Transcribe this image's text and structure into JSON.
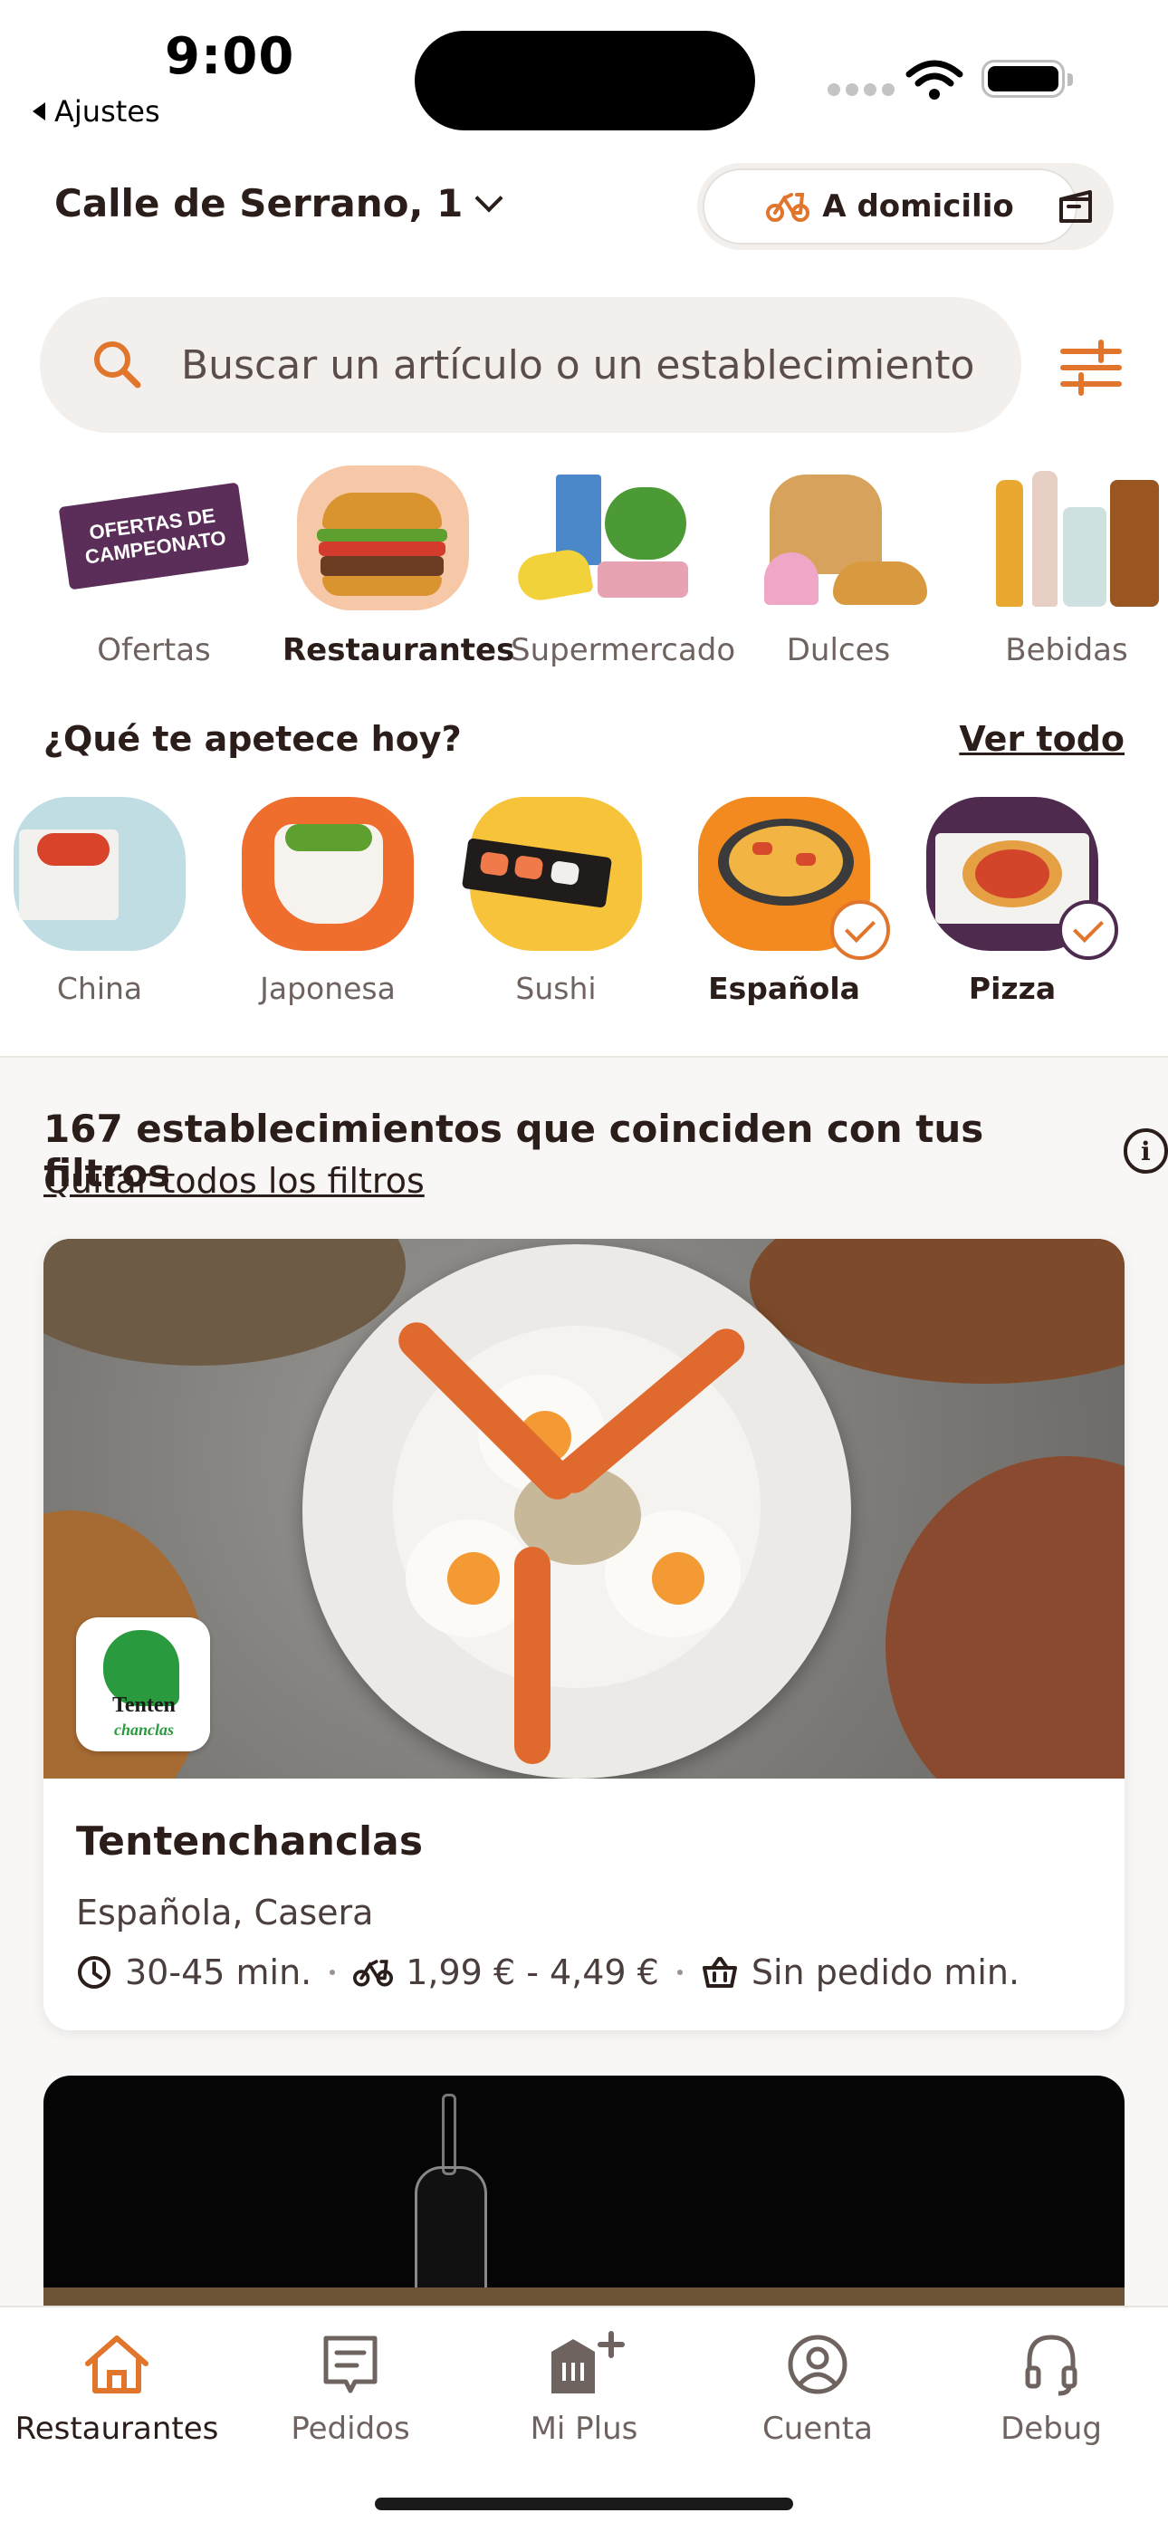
{
  "status_bar": {
    "time": "9:00",
    "back_app": "Ajustes"
  },
  "header": {
    "address": "Calle de Serrano, 1",
    "delivery_mode": "A domicilio"
  },
  "search": {
    "placeholder": "Buscar un artículo o un establecimiento"
  },
  "categories": [
    {
      "label": "Ofertas",
      "badge_line1": "OFERTAS DE",
      "badge_line2": "CAMPEONATO"
    },
    {
      "label": "Restaurantes"
    },
    {
      "label": "Supermercado"
    },
    {
      "label": "Dulces"
    },
    {
      "label": "Bebidas"
    }
  ],
  "cuisine_section": {
    "title": "¿Qué te apetece hoy?",
    "see_all": "Ver todo",
    "items": [
      {
        "label": "China",
        "selected": false,
        "bg": "#bfdde3"
      },
      {
        "label": "Japonesa",
        "selected": false,
        "bg": "#ef6d2d"
      },
      {
        "label": "Sushi",
        "selected": false,
        "bg": "#f6c33b"
      },
      {
        "label": "Española",
        "selected": true,
        "bg": "#f28a1f"
      },
      {
        "label": "Pizza",
        "selected": true,
        "bg": "#4e2a4f"
      }
    ]
  },
  "results": {
    "title": "167 establecimientos que coinciden con tus filtros",
    "clear_filters": "Quitar todos los filtros"
  },
  "restaurants": [
    {
      "name": "Tentenchanclas",
      "logo_line1": "Tenten",
      "logo_line2": "chanclas",
      "tags": "Española, Casera",
      "time": "30-45 min.",
      "delivery_fee": "1,99 € - 4,49 €",
      "min_order": "Sin pedido min."
    }
  ],
  "tabbar": [
    {
      "label": "Restaurantes",
      "active": true
    },
    {
      "label": "Pedidos"
    },
    {
      "label": "Mi Plus"
    },
    {
      "label": "Cuenta"
    },
    {
      "label": "Debug"
    }
  ],
  "colors": {
    "accent": "#e0752b",
    "text": "#2b1d1a",
    "muted": "#6f6360"
  }
}
